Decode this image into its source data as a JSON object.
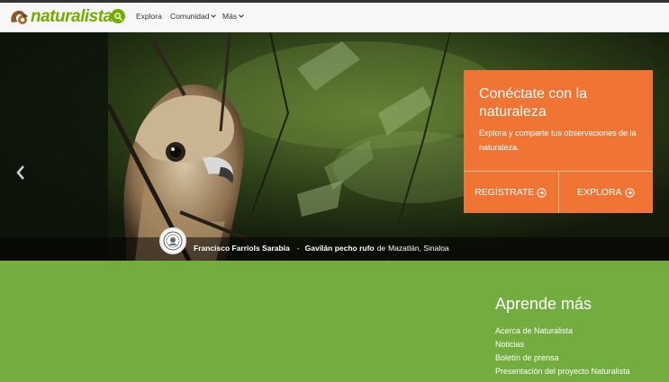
{
  "brand": {
    "name": "naturalista",
    "color": "#74ac00"
  },
  "header": {
    "search_icon": "search-icon",
    "nav": [
      {
        "label": "Explora",
        "has_menu": false
      },
      {
        "label": "Comunidad",
        "has_menu": true
      },
      {
        "label": "Más",
        "has_menu": true
      }
    ]
  },
  "hero": {
    "cta": {
      "title": "Conéctate con la naturaleza",
      "subtitle": "Explora y comparte tus observaciones de la naturaleza.",
      "signup_label": "REGÍSTRATE",
      "explore_label": "EXPLORA",
      "color": "#f07534"
    },
    "caption": {
      "observer": "Francisco Farriols Sarabia",
      "separator": "-",
      "species": "Gavilán pecho rufo",
      "place_prefix": "de",
      "place": "Mazatlán, Sinaloa"
    }
  },
  "learn_more": {
    "title": "Aprende más",
    "links": [
      "Acerca de Naturalista",
      "Noticias",
      "Boletín de prensa",
      "Presentación del proyecto Naturalista"
    ],
    "color": "#73ac3f"
  }
}
